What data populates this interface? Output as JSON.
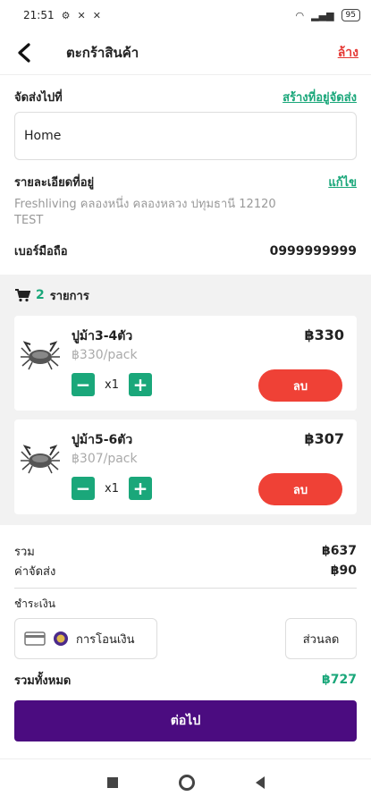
{
  "status_bar": {
    "time": "21:51",
    "battery": "95"
  },
  "header": {
    "title": "ตะกร้าสินค้า",
    "clear_label": "ล้าง",
    "back_icon": "chevron-left-icon"
  },
  "shipping": {
    "label": "จัดส่งไปที่",
    "create_link": "สร้างที่อยู่จัดส่ง",
    "selected_address": "Home",
    "detail_label": "รายละเอียดที่อยู่",
    "edit_link": "แก้ไข",
    "address_line1": "Freshliving คลองหนึ่ง คลองหลวง ปทุมธานี 12120",
    "address_line2": "TEST",
    "phone_label": "เบอร์มือถือ",
    "phone_value": "0999999999"
  },
  "cart": {
    "count": "2",
    "items_label": "รายการ",
    "items": [
      {
        "name": "ปูม้า3-4ตัว",
        "unit_price": "฿330/pack",
        "price": "฿330",
        "qty": "x1",
        "delete_label": "ลบ"
      },
      {
        "name": "ปูม้า5-6ตัว",
        "unit_price": "฿307/pack",
        "price": "฿307",
        "qty": "x1",
        "delete_label": "ลบ"
      }
    ]
  },
  "summary": {
    "subtotal_label": "รวม",
    "subtotal_value": "฿637",
    "shipping_label": "ค่าจัดส่ง",
    "shipping_value": "฿90",
    "payment_label": "ชำระเงิน",
    "payment_method": "การโอนเงิน",
    "discount_label": "ส่วนลด",
    "total_label": "รวมทั้งหมด",
    "total_value": "฿727",
    "next_label": "ต่อไป"
  },
  "colors": {
    "accent_green": "#1aa77a",
    "delete_red": "#ef4136",
    "primary_purple": "#4b0c80"
  }
}
